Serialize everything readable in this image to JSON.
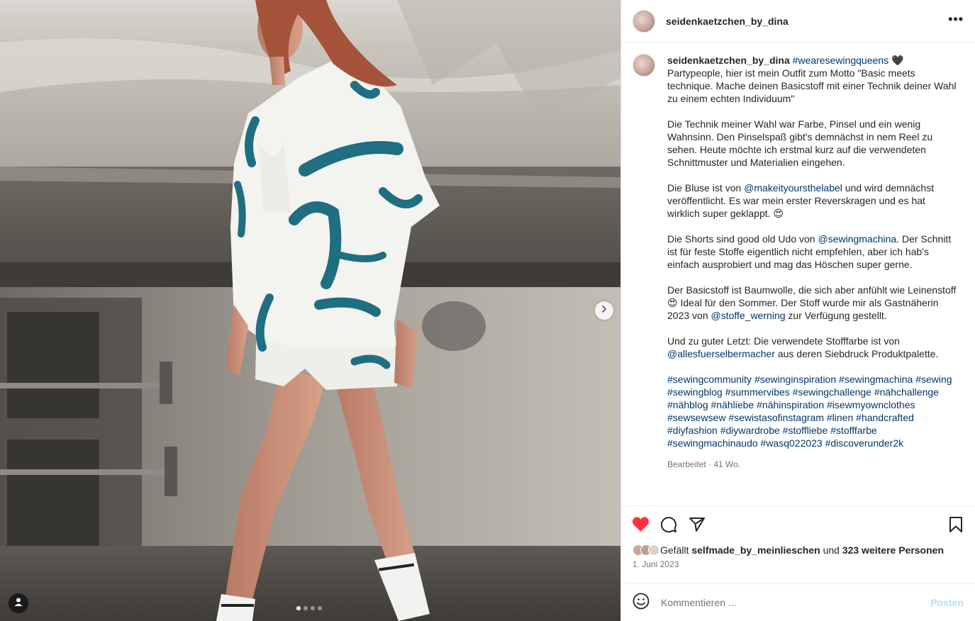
{
  "post": {
    "username": "seidenkaetzchen_by_dina",
    "more_icon": "more-horizontal-icon"
  },
  "media": {
    "slide_count": 4,
    "active_slide": 1,
    "next_icon": "chevron-right-icon",
    "tag_icon": "user-tag-icon"
  },
  "caption": {
    "username": "seidenkaetzchen_by_dina",
    "p1_tag": "#wearesewingqueens",
    "p1_emoji": "🖤",
    "p1_text": "Partypeople, hier ist mein Outfit zum Motto \"Basic meets technique. Mache deinen Basicstoff mit einer Technik deiner Wahl zu einem echten Individuum\"",
    "p2_text": "Die Technik meiner Wahl war Farbe, Pinsel und ein wenig Wahnsinn. Den Pinselspaß gibt's demnächst in nem Reel zu sehen. Heute möchte ich erstmal kurz auf die verwendeten Schnittmuster und Materialien eingehen.",
    "p3_a": "Die Bluse ist von",
    "p3_mention": "@makeityoursthelabel",
    "p3_b": "und wird demnächst veröffentlicht. Es war mein erster Reverskragen und es hat wirklich super geklappt. 😍",
    "p4_a": "Die Shorts sind good old Udo von",
    "p4_mention": "@sewingmachina",
    "p4_b": ". Der Schnitt ist für feste Stoffe eigentlich nicht empfehlen, aber ich hab's einfach ausprobiert und mag das Höschen super gerne.",
    "p5_a": "Der Basicstoff ist Baumwolle, die sich aber anfühlt wie Leinenstoff 😍 Ideal für den Sommer. Der Stoff wurde mir als Gastnäherin 2023 von",
    "p5_mention": "@stoffe_werning",
    "p5_b": "zur Verfügung gestellt.",
    "p6_a": "Und zu guter Letzt: Die verwendete Stofffarbe ist von",
    "p6_mention": "@allesfuerselbermacher",
    "p6_b": "aus deren Siebdruck Produktpalette.",
    "hashtags": [
      "#sewingcommunity",
      "#sewinginspiration",
      "#sewingmachina",
      "#sewing",
      "#sewingblog",
      "#summervibes",
      "#sewingchallenge",
      "#nähchallenge",
      "#nähblog",
      "#nähliebe",
      "#nähinspiration",
      "#isewmyownclothes",
      "#sewsewsew",
      "#sewistasofinstagram",
      "#linen",
      "#handcrafted",
      "#diyfashion",
      "#diywardrobe",
      "#stoffliebe",
      "#stofffarbe",
      "#sewingmachinaudo",
      "#wasq022023",
      "#discoverunder2k"
    ],
    "meta": "Bearbeitet · 41 Wo."
  },
  "actions": {
    "like_icon": "heart-filled-icon",
    "comment_icon": "comment-icon",
    "share_icon": "send-icon",
    "save_icon": "bookmark-icon",
    "like_color": "#ff3040"
  },
  "likes": {
    "prefix": "Gefällt",
    "user": "selfmade_by_meinlieschen",
    "middle": "und",
    "others": "323 weitere Personen"
  },
  "date": "1. Juni 2023",
  "comment": {
    "emoji_icon": "smiley-icon",
    "placeholder": "Kommentieren ...",
    "post_label": "Posten"
  }
}
